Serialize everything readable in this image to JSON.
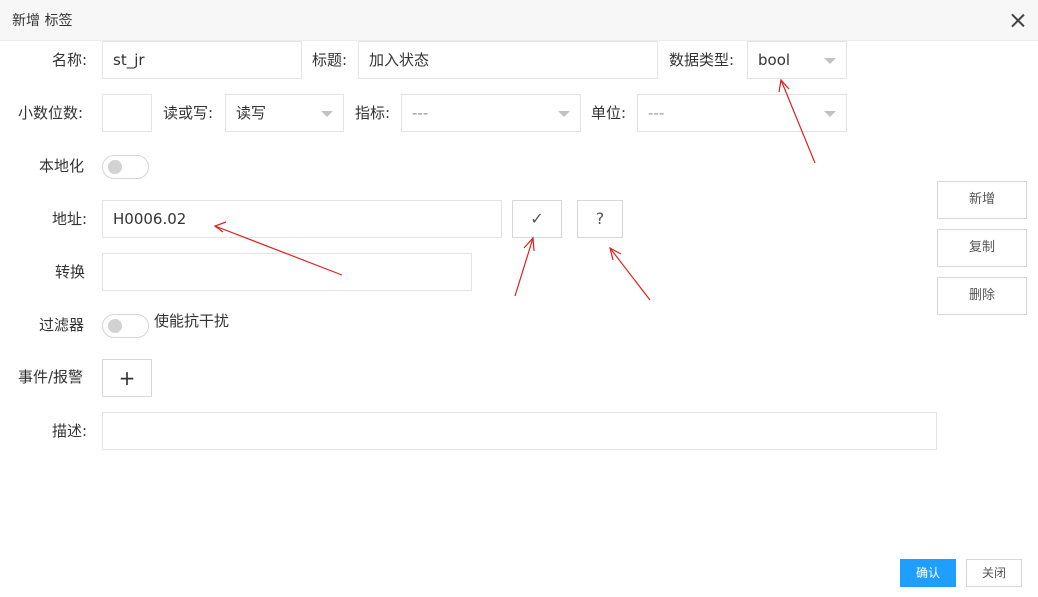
{
  "dialog": {
    "title": "新增 标签"
  },
  "form": {
    "name": {
      "label": "名称:",
      "value": "st_jr"
    },
    "title": {
      "label": "标题:",
      "value": "加入状态"
    },
    "datatype": {
      "label": "数据类型:",
      "value": "bool"
    },
    "decimals": {
      "label": "小数位数:",
      "value": ""
    },
    "readwrite": {
      "label": "读或写:",
      "value": "读写"
    },
    "indicator": {
      "label": "指标:",
      "value": "---"
    },
    "unit": {
      "label": "单位:",
      "value": "---"
    },
    "localize": {
      "label": "本地化",
      "enabled": false
    },
    "address": {
      "label": "地址:",
      "value": "H0006.02"
    },
    "convert": {
      "label": "转换",
      "value": ""
    },
    "filter": {
      "label": "过滤器",
      "enabled": false,
      "caption": "使能抗干扰"
    },
    "event": {
      "label": "事件/报警",
      "add_symbol": "+"
    },
    "description": {
      "label": "描述:",
      "value": ""
    },
    "check_symbol": "✓",
    "help_symbol": "?"
  },
  "side": {
    "add": "新增",
    "copy": "复制",
    "delete": "删除"
  },
  "footer": {
    "confirm": "确认",
    "close": "关闭"
  },
  "colors": {
    "primary": "#1e9fff",
    "annotation": "#e02020"
  },
  "icons": [
    "close-icon",
    "check-icon",
    "help-icon",
    "plus-icon",
    "chevron-down-icon"
  ]
}
